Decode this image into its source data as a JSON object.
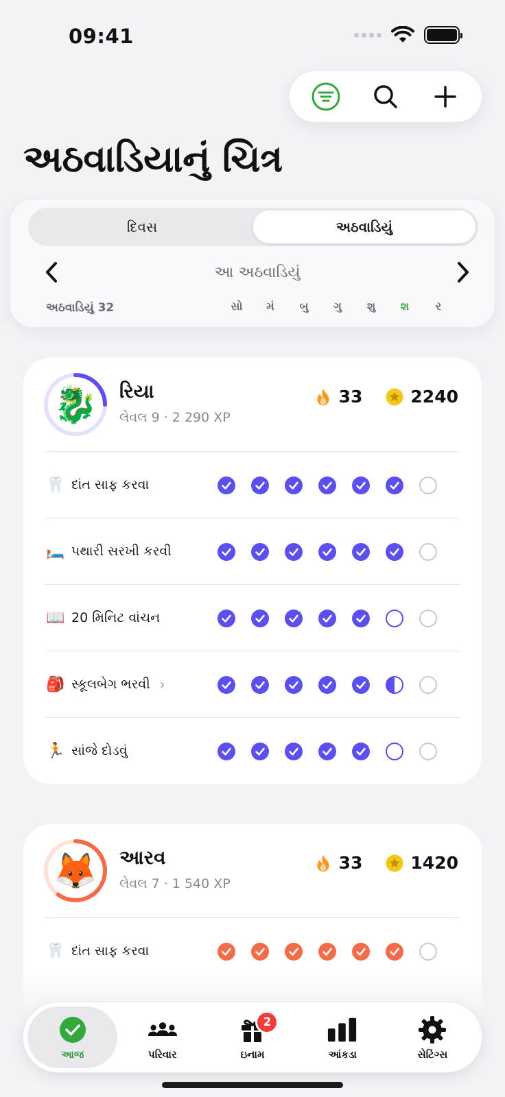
{
  "status_bar": {
    "time": "09:41"
  },
  "page": {
    "title": "અઠવાડિયાનું ચિત્ર"
  },
  "week": {
    "segments": [
      {
        "label": "દિવસ",
        "active": false
      },
      {
        "label": "અઠવાડિયું",
        "active": true
      }
    ],
    "label": "આ અઠવાડિયું",
    "week_number": "અઠવાડિયું 32",
    "days": [
      "સો",
      "મં",
      "બુ",
      "ગુ",
      "શુ",
      "શ",
      "ર"
    ],
    "today_index": 5,
    "today_color": "#34a83a"
  },
  "people": [
    {
      "name": "રિયા",
      "avatar_emoji": "🐉",
      "level_text": "લેવલ 9 · 2 290 XP",
      "level_progress": 0.25,
      "ring_color": "#5b4ff0",
      "ring_track": "#e3e1fc",
      "streak": "33",
      "stars": "2240",
      "check_color": "#5b4ff0",
      "tasks": [
        {
          "emoji": "🦷",
          "label": "દાંત સાફ કરવા",
          "has_chevron": false,
          "states": [
            "done",
            "done",
            "done",
            "done",
            "done",
            "done",
            "empty"
          ]
        },
        {
          "emoji": "🛏️",
          "label": "પથારી સરખી કરવી",
          "has_chevron": false,
          "states": [
            "done",
            "done",
            "done",
            "done",
            "done",
            "done",
            "empty"
          ]
        },
        {
          "emoji": "📖",
          "label": "20 મિનિટ વાંચન",
          "has_chevron": false,
          "states": [
            "done",
            "done",
            "done",
            "done",
            "done",
            "pending",
            "empty"
          ]
        },
        {
          "emoji": "🎒",
          "label": "સ્કૂલબેગ ભરવી",
          "has_chevron": true,
          "states": [
            "done",
            "done",
            "done",
            "done",
            "done",
            "half",
            "empty"
          ]
        },
        {
          "emoji": "🏃",
          "label": "સાંજે દોડવું",
          "has_chevron": false,
          "states": [
            "done",
            "done",
            "done",
            "done",
            "done",
            "pending",
            "empty"
          ]
        }
      ]
    },
    {
      "name": "આરવ",
      "avatar_emoji": "🦊",
      "level_text": "લેવલ 7 · 1 540 XP",
      "level_progress": 0.6,
      "ring_color": "#f46b4a",
      "ring_track": "#fde1da",
      "streak": "33",
      "stars": "1420",
      "check_color": "#f46b4a",
      "tasks": [
        {
          "emoji": "🦷",
          "label": "દાંત સાફ કરવા",
          "has_chevron": false,
          "states": [
            "done",
            "done",
            "done",
            "done",
            "done",
            "done",
            "empty"
          ]
        }
      ]
    }
  ],
  "tabs": [
    {
      "label": "આજ",
      "icon": "check-circle-icon",
      "active": true
    },
    {
      "label": "પરિવાર",
      "icon": "people-icon",
      "active": false
    },
    {
      "label": "ઇનામ",
      "icon": "gift-icon",
      "active": false,
      "badge": "2"
    },
    {
      "label": "આંકડા",
      "icon": "bar-chart-icon",
      "active": false
    },
    {
      "label": "સેટિંગ્સ",
      "icon": "gear-icon",
      "active": false
    }
  ],
  "colors": {
    "accent_green": "#34a83a",
    "flame": "#f59a23",
    "star": "#f5c518",
    "badge_red": "#f23b3b"
  }
}
